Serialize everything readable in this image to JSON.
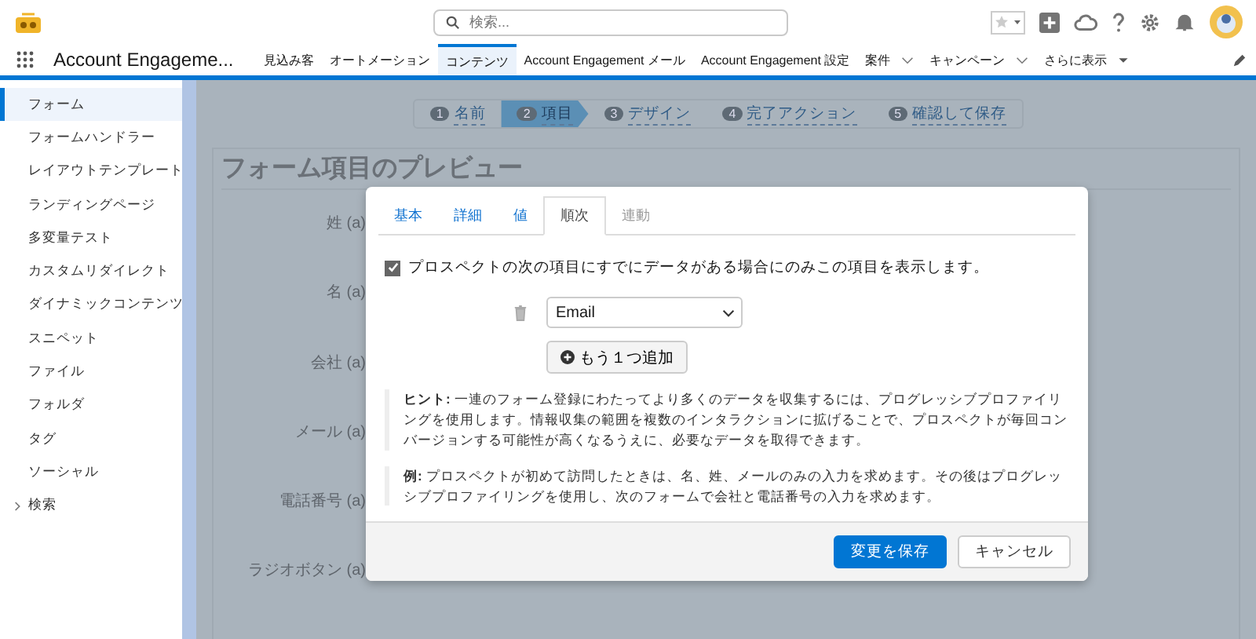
{
  "search": {
    "placeholder": "検索..."
  },
  "app_name": "Account Engageme...",
  "nav": [
    {
      "label": "見込み客",
      "selected": false,
      "kind": "plain"
    },
    {
      "label": "オートメーション",
      "selected": false,
      "kind": "plain"
    },
    {
      "label": "コンテンツ",
      "selected": true,
      "kind": "plain"
    },
    {
      "label": "Account Engagement メール",
      "selected": false,
      "kind": "plain"
    },
    {
      "label": "Account Engagement 設定",
      "selected": false,
      "kind": "plain"
    },
    {
      "label": "案件",
      "selected": false,
      "kind": "menu"
    },
    {
      "label": "キャンペーン",
      "selected": false,
      "kind": "menu"
    },
    {
      "label": "さらに表示",
      "selected": false,
      "kind": "more"
    }
  ],
  "sidebar": {
    "items": [
      {
        "label": "フォーム",
        "selected": true,
        "kind": "link"
      },
      {
        "label": "フォームハンドラー",
        "selected": false,
        "kind": "link"
      },
      {
        "label": "レイアウトテンプレート",
        "selected": false,
        "kind": "link"
      },
      {
        "label": "ランディングページ",
        "selected": false,
        "kind": "link"
      },
      {
        "label": "多変量テスト",
        "selected": false,
        "kind": "link"
      },
      {
        "label": "カスタムリダイレクト",
        "selected": false,
        "kind": "link"
      },
      {
        "label": "ダイナミックコンテンツ",
        "selected": false,
        "kind": "link"
      },
      {
        "label": "スニペット",
        "selected": false,
        "kind": "link"
      },
      {
        "label": "ファイル",
        "selected": false,
        "kind": "link"
      },
      {
        "label": "フォルダ",
        "selected": false,
        "kind": "link"
      },
      {
        "label": "タグ",
        "selected": false,
        "kind": "link"
      },
      {
        "label": "ソーシャル",
        "selected": false,
        "kind": "link"
      },
      {
        "label": "検索",
        "selected": false,
        "kind": "group"
      }
    ]
  },
  "steps": [
    {
      "number": "1",
      "label": "名前",
      "selected": false
    },
    {
      "number": "2",
      "label": "項目",
      "selected": true
    },
    {
      "number": "3",
      "label": "デザイン",
      "selected": false
    },
    {
      "number": "4",
      "label": "完了アクション",
      "selected": false
    },
    {
      "number": "5",
      "label": "確認して保存",
      "selected": false
    }
  ],
  "preview": {
    "title": "フォーム項目のプレビュー",
    "fields": [
      "姓 (a)",
      "名 (a)",
      "会社 (a)",
      "メール (a)",
      "電話番号 (a)",
      "ラジオボタン (a)"
    ]
  },
  "dialog": {
    "tabs": [
      {
        "label": "基本",
        "selected": false,
        "disabled": false
      },
      {
        "label": "詳細",
        "selected": false,
        "disabled": false
      },
      {
        "label": "値",
        "selected": false,
        "disabled": false
      },
      {
        "label": "順次",
        "selected": true,
        "disabled": false
      },
      {
        "label": "連動",
        "selected": false,
        "disabled": true
      }
    ],
    "option": {
      "label": "プロスペクトの次の項目にすでにデータがある場合にのみこの項目を表示します。",
      "checked": true
    },
    "field_select": {
      "value": "Email"
    },
    "add_button": "もう１つ追加",
    "hint": "**ヒント:** 一連のフォーム登録にわたってより多くのデータを収集するには、プログレッシブプロファイリングを使用します。情報収集の範囲を複数のインタラクションに拡げることで、プロスペクトが毎回コンバージョンする可能性が高くなるうえに、必要なデータを取得できます。",
    "example": "**例:** プロスペクトが初めて訪問したときは、名、姓、メールのみの入力を求めます。その後はプログレッシブプロファイリングを使用し、次のフォームで会社と電話番号の入力を求めます。",
    "buttons": {
      "save": "変更を保存",
      "cancel": "キャンセル"
    }
  }
}
